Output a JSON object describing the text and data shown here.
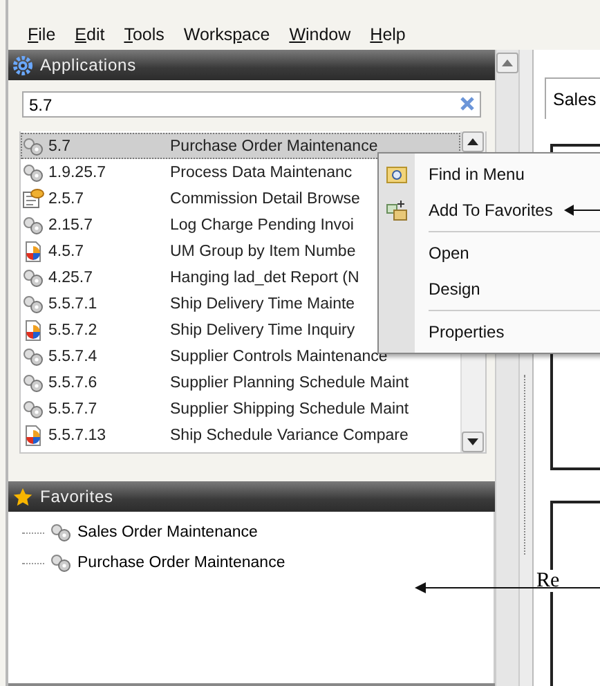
{
  "menu": [
    {
      "key": "F",
      "post": "ile"
    },
    {
      "key": "E",
      "post": "dit"
    },
    {
      "key": "T",
      "post": "ools"
    },
    {
      "pre": "Works",
      "key": "p",
      "post": "ace"
    },
    {
      "key": "W",
      "post": "indow"
    },
    {
      "key": "H",
      "post": "elp"
    }
  ],
  "applications": {
    "title": "Applications",
    "search": {
      "value": "5.7"
    },
    "rows": [
      {
        "kind": "gear",
        "code": "5.7",
        "name": "Purchase Order Maintenance",
        "selected": true
      },
      {
        "kind": "gear",
        "code": "1.9.25.7",
        "name": "Process Data Maintenanc",
        "selected": false
      },
      {
        "kind": "browse",
        "code": "2.5.7",
        "name": "Commission Detail Browse",
        "selected": false
      },
      {
        "kind": "gear",
        "code": "2.15.7",
        "name": "Log Charge Pending Invoi",
        "selected": false
      },
      {
        "kind": "report",
        "code": "4.5.7",
        "name": "UM Group by Item Numbe",
        "selected": false
      },
      {
        "kind": "gear",
        "code": "4.25.7",
        "name": "Hanging lad_det Report (N",
        "selected": false
      },
      {
        "kind": "gear",
        "code": "5.5.7.1",
        "name": "Ship Delivery Time Mainte",
        "selected": false
      },
      {
        "kind": "report",
        "code": "5.5.7.2",
        "name": "Ship Delivery Time Inquiry",
        "selected": false
      },
      {
        "kind": "gear",
        "code": "5.5.7.4",
        "name": "Supplier Controls Maintenance",
        "selected": false
      },
      {
        "kind": "gear",
        "code": "5.5.7.6",
        "name": "Supplier Planning Schedule Maint",
        "selected": false
      },
      {
        "kind": "gear",
        "code": "5.5.7.7",
        "name": "Supplier Shipping Schedule Maint",
        "selected": false
      },
      {
        "kind": "report",
        "code": "5.5.7.13",
        "name": "Ship Schedule Variance Compare",
        "selected": false
      }
    ]
  },
  "favorites": {
    "title": "Favorites",
    "items": [
      "Sales Order Maintenance",
      "Purchase Order Maintenance"
    ]
  },
  "context_menu": [
    {
      "kind": "find",
      "label": "Find in Menu"
    },
    {
      "kind": "favorite",
      "label": "Add To Favorites"
    },
    {
      "kind": "separator"
    },
    {
      "kind": "plain",
      "label": "Open"
    },
    {
      "kind": "plain",
      "label": "Design"
    },
    {
      "kind": "separator"
    },
    {
      "kind": "plain",
      "label": "Properties"
    }
  ],
  "document": {
    "tab": "Sales",
    "box_text": "Re"
  }
}
